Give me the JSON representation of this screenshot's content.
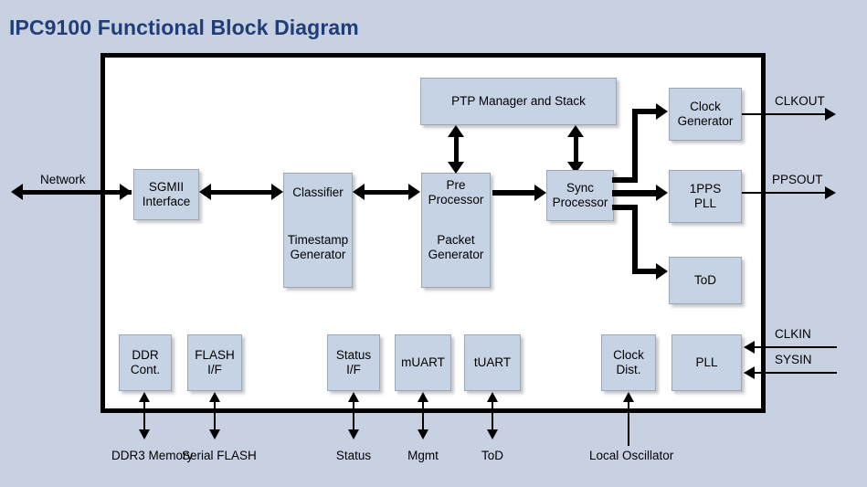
{
  "title": "IPC9100 Functional Block Diagram",
  "theme": {
    "page_bg": "#c8d1e2",
    "chip_bg": "#ffffff",
    "block_fill": "#c6d3e4",
    "block_border": "#9aa7b8",
    "line": "#000000",
    "title_color": "#1f3d78"
  },
  "blocks": {
    "sgmii": {
      "line1": "SGMII",
      "line2": "Interface"
    },
    "classifier": {
      "line1": "Classifier",
      "line2": "Timestamp",
      "line3": "Generator"
    },
    "preproc": {
      "line1": "Pre",
      "line2": "Processor",
      "line3": "Packet",
      "line4": "Generator"
    },
    "ptp": {
      "line1": "PTP Manager and Stack"
    },
    "sync": {
      "line1": "Sync",
      "line2": "Processor"
    },
    "clockgen": {
      "line1": "Clock",
      "line2": "Generator"
    },
    "pps_pll": {
      "line1": "1PPS",
      "line2": "PLL"
    },
    "tod": {
      "line1": "ToD"
    },
    "ddr": {
      "line1": "DDR",
      "line2": "Cont."
    },
    "flash": {
      "line1": "FLASH",
      "line2": "I/F"
    },
    "status_if": {
      "line1": "Status",
      "line2": "I/F"
    },
    "muart": {
      "line1": "mUART"
    },
    "tuart": {
      "line1": "tUART"
    },
    "clkdist": {
      "line1": "Clock",
      "line2": "Dist."
    },
    "pll": {
      "line1": "PLL"
    }
  },
  "io_labels": {
    "network": "Network",
    "clkout": "CLKOUT",
    "ppsout": "PPSOUT",
    "clkin": "CLKIN",
    "sysin": "SYSIN",
    "ddr3_memory_l1": "DDR3",
    "ddr3_memory_l2": "Memory",
    "serial_flash_l1": "Serial",
    "serial_flash_l2": "FLASH",
    "status": "Status",
    "mgmt": "Mgmt",
    "tod": "ToD",
    "local_osc_l1": "Local",
    "local_osc_l2": "Oscillator"
  }
}
